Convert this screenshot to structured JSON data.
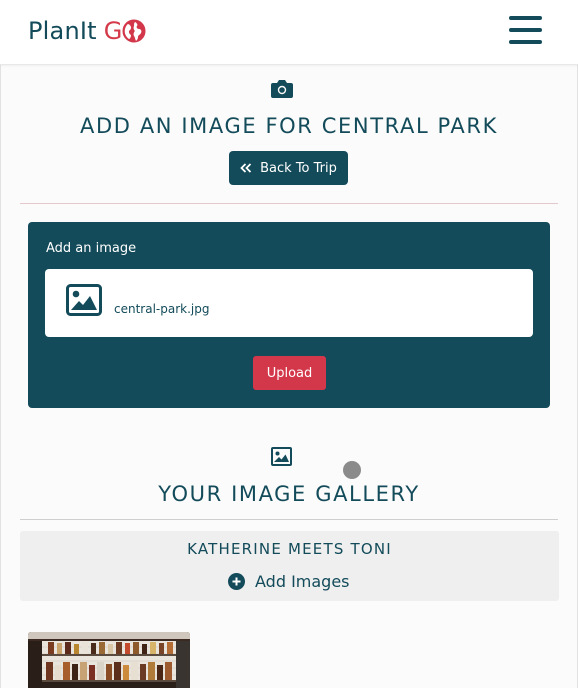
{
  "header": {
    "brand_text": "PlanIt",
    "brand_g": "G",
    "brand_globe_icon": "globe-icon",
    "menu_icon": "hamburger-menu-icon"
  },
  "upload_section": {
    "icon": "camera-icon",
    "title": "ADD AN IMAGE FOR CENTRAL PARK",
    "back_button_label": "Back To Trip",
    "back_icon": "double-chevron-left-icon",
    "form_label": "Add an image",
    "file_icon": "image-icon",
    "file_name": "central-park.jpg",
    "upload_button_label": "Upload"
  },
  "gallery_section": {
    "icon": "image-icon",
    "title": "YOUR IMAGE GALLERY",
    "albums": [
      {
        "title": "KATHERINE MEETS TONI",
        "add_label": "Add Images",
        "add_icon": "plus-circle-icon"
      }
    ]
  },
  "colors": {
    "primary": "#134b5a",
    "accent": "#d3374a",
    "card_bg": "#efefef",
    "page_bg": "#fbfbfb"
  }
}
